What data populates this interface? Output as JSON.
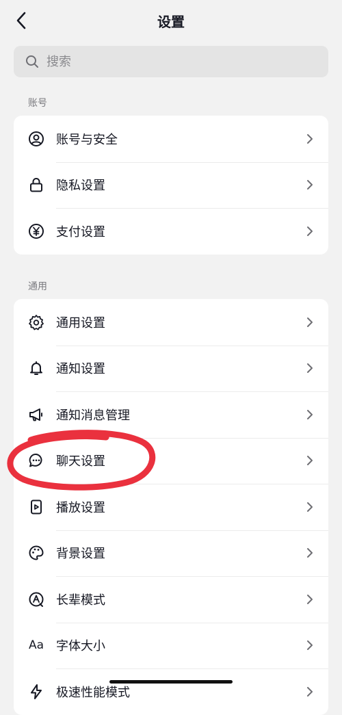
{
  "header": {
    "title": "设置"
  },
  "search": {
    "placeholder": "搜索"
  },
  "sections": [
    {
      "label": "账号",
      "items": [
        {
          "label": "账号与安全",
          "icon": "user-circle-icon"
        },
        {
          "label": "隐私设置",
          "icon": "lock-icon"
        },
        {
          "label": "支付设置",
          "icon": "yen-icon"
        }
      ]
    },
    {
      "label": "通用",
      "items": [
        {
          "label": "通用设置",
          "icon": "gear-icon"
        },
        {
          "label": "通知设置",
          "icon": "bell-icon"
        },
        {
          "label": "通知消息管理",
          "icon": "megaphone-icon"
        },
        {
          "label": "聊天设置",
          "icon": "chat-bubble-icon"
        },
        {
          "label": "播放设置",
          "icon": "play-icon"
        },
        {
          "label": "背景设置",
          "icon": "palette-icon"
        },
        {
          "label": "长辈模式",
          "icon": "elder-mode-icon"
        },
        {
          "label": "字体大小",
          "icon": "font-size-icon",
          "glyph": "Aa"
        },
        {
          "label": "极速性能模式",
          "icon": "bolt-icon"
        }
      ]
    }
  ],
  "colors": {
    "background": "#f2f2f2",
    "annotation": "#e8202e",
    "text": "#161823"
  }
}
